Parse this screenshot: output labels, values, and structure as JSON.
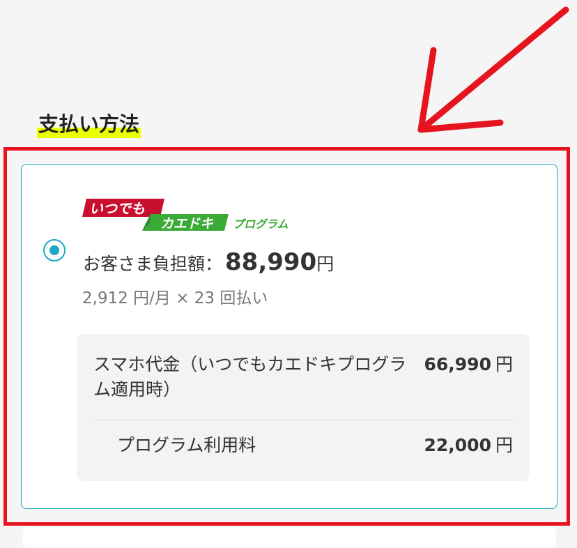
{
  "section": {
    "title": "支払い方法"
  },
  "payment_option": {
    "selected": true,
    "logo": {
      "part1": "いつでも",
      "part2": "カエドキ",
      "part3": "プログラム",
      "colors": {
        "red": "#c8102e",
        "green": "#3caa36"
      }
    },
    "burden_label": "お客さま負担額：",
    "burden_amount": "88,990",
    "burden_unit": "円",
    "installment": "2,912 円/月 × 23 回払い",
    "breakdown": [
      {
        "label": "スマホ代金（いつでもカエドキプログラム適用時）",
        "value": "66,990",
        "unit": "円"
      },
      {
        "label": "プログラム利用料",
        "value": "22,000",
        "unit": "円"
      }
    ]
  },
  "annotation": {
    "frame_color": "#e5141f",
    "arrow_icon": "arrow-down-left-icon"
  },
  "colors": {
    "accent": "#1aa8c4",
    "highlight": "#eaff00",
    "annotation": "#e5141f"
  }
}
